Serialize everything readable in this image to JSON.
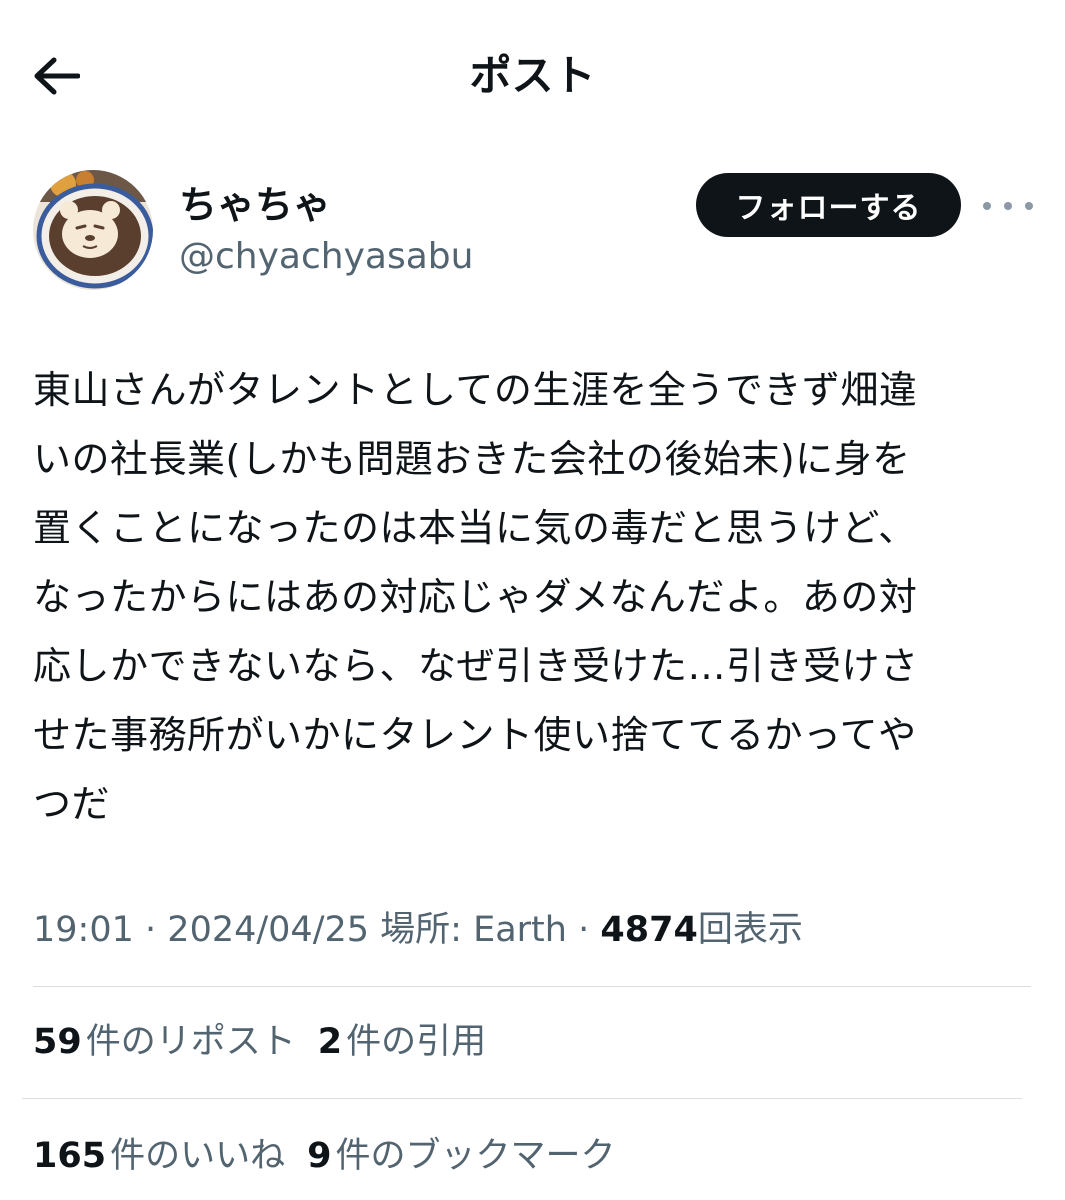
{
  "header": {
    "title": "ポスト",
    "back_icon": "arrow-left-icon"
  },
  "author": {
    "display_name": "ちゃちゃ",
    "handle": "@chyachyasabu",
    "follow_label": "フォローする",
    "more_icon": "more-horizontal-icon"
  },
  "post": {
    "lines": [
      "東山さんがタレントとしての生涯を全うできず畑違",
      "いの社長業(しかも問題おきた会社の後始末)に身を",
      "置くことになったのは本当に気の毒だと思うけど、",
      "なったからにはあの対応じゃダメなんだよ。あの対",
      "応しかできないなら、なぜ引き受けた…引き受けさ",
      "せた事務所がいかにタレント使い捨ててるかってや",
      "つだ"
    ]
  },
  "meta": {
    "time": "19:01",
    "sep1": "·",
    "date": "2024/04/25",
    "location_label": "場所:",
    "location": "Earth",
    "sep2": "·",
    "views_count": "4874",
    "views_label": "回表示"
  },
  "stats": {
    "reposts_count": "59",
    "reposts_label": "件のリポスト",
    "quotes_count": "2",
    "quotes_label": "件の引用",
    "likes_count": "165",
    "likes_label": "件のいいね",
    "bookmarks_count": "9",
    "bookmarks_label": "件のブックマーク"
  },
  "colors": {
    "primary_text": "#0f1419",
    "secondary_text": "#536471",
    "follow_bg": "#0f1419",
    "divider": "#dadfe3"
  }
}
